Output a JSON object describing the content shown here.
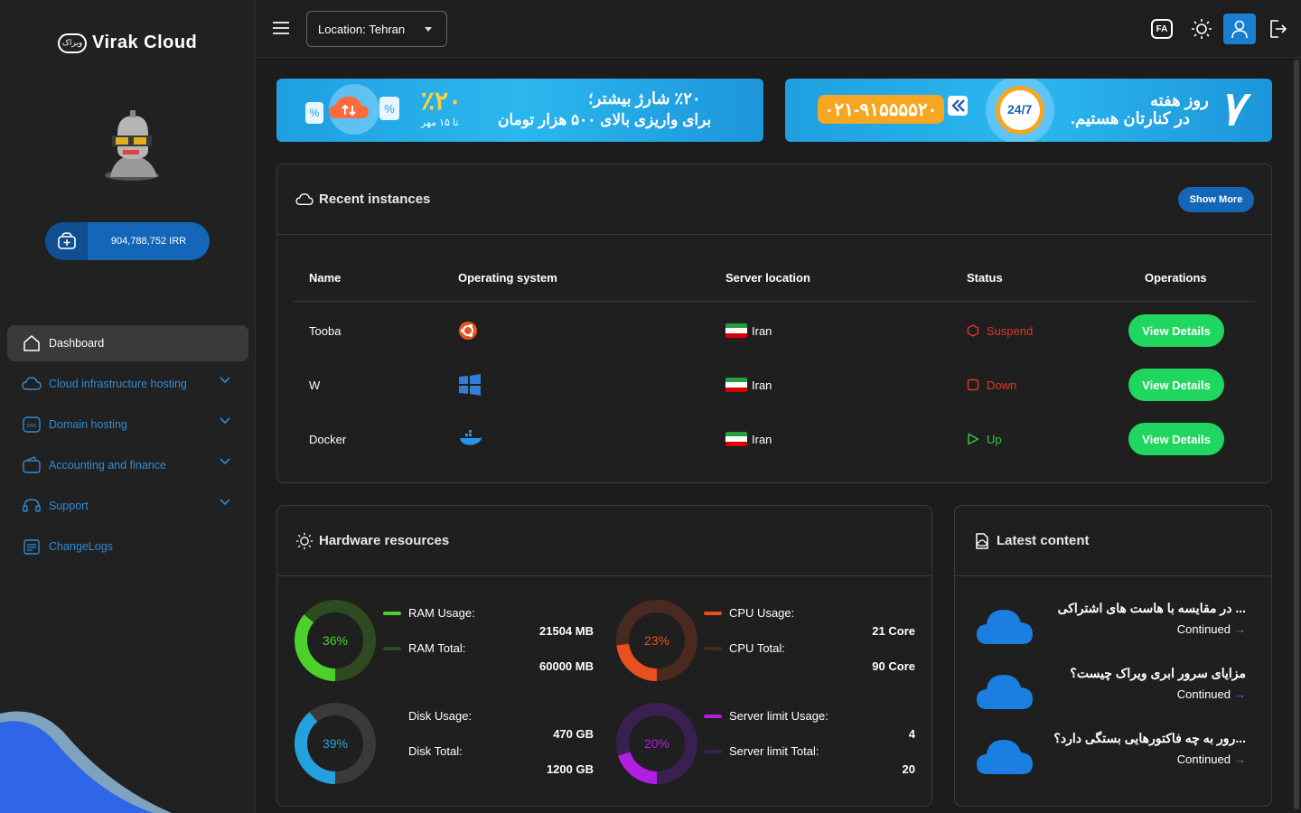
{
  "sidebar": {
    "logo_text": "Virak Cloud",
    "logo_mark": "ویراک",
    "balance": "904,788,752 IRR",
    "menu": [
      {
        "label": "Dashboard",
        "icon": "home-icon",
        "active": true
      },
      {
        "label": "Cloud infrastructure hosting",
        "icon": "cloud-icon"
      },
      {
        "label": "Domain hosting",
        "icon": "dns-icon"
      },
      {
        "label": "Accounting and finance",
        "icon": "wallet-icon"
      },
      {
        "label": "Support",
        "icon": "support-icon"
      },
      {
        "label": "ChangeLogs",
        "icon": "changelog-icon"
      }
    ]
  },
  "topbar": {
    "location_prefix": "Location:",
    "location_value": "Tehran",
    "lang_btn": "FA"
  },
  "banners": {
    "b1_percent": "٪۲۰",
    "b1_until": "تا ۱۵ مهر",
    "b1_line1": "٪۲۰ شارژ بیشتر؛",
    "b1_line2": "برای واریزی بالای ۵۰۰ هزار تومان",
    "b2_phone": "۰۲۱-۹۱۵۵۵۵۲۰",
    "b2_badge": "24/7",
    "b2_line1": "روز هفته",
    "b2_line2": "در کنارتان هستیم.",
    "b2_big": "۷"
  },
  "recent": {
    "title": "Recent instances",
    "show_more": "Show More",
    "columns": [
      "Name",
      "Operating system",
      "Server location",
      "Status",
      "Operations"
    ],
    "rows": [
      {
        "name": "Tooba",
        "os": "ubuntu-icon",
        "location": "Iran",
        "status": "Suspend",
        "status_color": "#e0342f",
        "action": "View Details"
      },
      {
        "name": "W",
        "os": "windows-icon",
        "location": "Iran",
        "status": "Down",
        "status_color": "#e0342f",
        "action": "View Details"
      },
      {
        "name": "Docker",
        "os": "docker-icon",
        "location": "Iran",
        "status": "Up",
        "status_color": "#2ecc40",
        "action": "View Details"
      }
    ]
  },
  "hardware": {
    "title": "Hardware resources",
    "gauges": [
      {
        "percent": 36,
        "label": "36%",
        "color": "#4cd02a",
        "track": "#2e4a20",
        "usage_label": "RAM Usage:",
        "total_label": "RAM Total:",
        "usage_value": "21504 MB",
        "total_value": "60000 MB",
        "total_swatch": "#2e4a20"
      },
      {
        "percent": 23,
        "label": "23%",
        "color": "#e8501f",
        "track": "#4a2a20",
        "usage_label": "CPU Usage:",
        "total_label": "CPU Total:",
        "usage_value": "21 Core",
        "total_value": "90 Core",
        "total_swatch": "#4a2a20"
      },
      {
        "percent": 39,
        "label": "39%",
        "color": "#24a0dc",
        "track": "#3a3a3a",
        "usage_label": "Disk Usage:",
        "total_label": "Disk Total:",
        "usage_value": "470 GB",
        "total_value": "1200 GB",
        "total_swatch": ""
      },
      {
        "percent": 20,
        "label": "20%",
        "color": "#b21fe0",
        "track": "#3a2050",
        "usage_label": "Server limit Usage:",
        "total_label": "Server limit Total:",
        "usage_value": "4",
        "total_value": "20",
        "total_swatch": "#3a2050"
      }
    ]
  },
  "latest": {
    "title": "Latest content",
    "posts": [
      {
        "title": "... در مقایسه با هاست های اشتراکی",
        "more": "Continued"
      },
      {
        "title": "مزایای سرور ابری ویراک چیست؟",
        "more": "Continued"
      },
      {
        "title": "...رور به چه فاکتورهایی بستگی دارد؟",
        "more": "Continued"
      }
    ]
  },
  "colors": {
    "accent": "#1466b8",
    "success": "#1fd65f",
    "sidebar_link": "#2f8bd6"
  }
}
